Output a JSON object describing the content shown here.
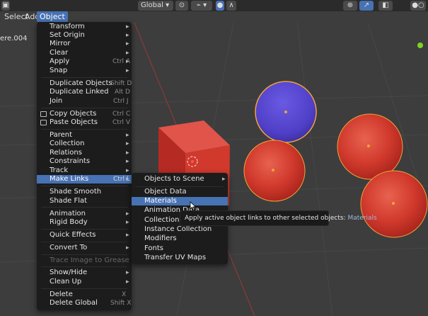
{
  "header": {
    "menus": [
      "Select",
      "Add",
      "Object"
    ],
    "orientation": "Global"
  },
  "viewport": {
    "object_name": "ere.004"
  },
  "object_menu": {
    "items": [
      {
        "label": "Transform",
        "shortcut": "",
        "submenu": true
      },
      {
        "label": "Set Origin",
        "shortcut": "",
        "submenu": true
      },
      {
        "label": "Mirror",
        "shortcut": "",
        "submenu": true
      },
      {
        "label": "Clear",
        "shortcut": "",
        "submenu": true
      },
      {
        "label": "Apply",
        "shortcut": "Ctrl A",
        "submenu": true
      },
      {
        "label": "Snap",
        "shortcut": "",
        "submenu": true
      },
      {
        "label": "Duplicate Objects",
        "shortcut": "Shift D"
      },
      {
        "label": "Duplicate Linked",
        "shortcut": "Alt D"
      },
      {
        "label": "Join",
        "shortcut": "Ctrl J"
      },
      {
        "label": "Copy Objects",
        "shortcut": "Ctrl C"
      },
      {
        "label": "Paste Objects",
        "shortcut": "Ctrl V"
      },
      {
        "label": "Parent",
        "shortcut": "",
        "submenu": true
      },
      {
        "label": "Collection",
        "shortcut": "",
        "submenu": true
      },
      {
        "label": "Relations",
        "shortcut": "",
        "submenu": true
      },
      {
        "label": "Constraints",
        "shortcut": "",
        "submenu": true
      },
      {
        "label": "Track",
        "shortcut": "",
        "submenu": true
      },
      {
        "label": "Make Links",
        "shortcut": "Ctrl L",
        "submenu": true
      },
      {
        "label": "Shade Smooth",
        "shortcut": ""
      },
      {
        "label": "Shade Flat",
        "shortcut": ""
      },
      {
        "label": "Animation",
        "shortcut": "",
        "submenu": true
      },
      {
        "label": "Rigid Body",
        "shortcut": "",
        "submenu": true
      },
      {
        "label": "Quick Effects",
        "shortcut": "",
        "submenu": true
      },
      {
        "label": "Convert To",
        "shortcut": "",
        "submenu": true
      },
      {
        "label": "Trace Image to Grease Pencil",
        "shortcut": ""
      },
      {
        "label": "Show/Hide",
        "shortcut": "",
        "submenu": true
      },
      {
        "label": "Clean Up",
        "shortcut": "",
        "submenu": true
      },
      {
        "label": "Delete",
        "shortcut": "X"
      },
      {
        "label": "Delete Global",
        "shortcut": "Shift X"
      }
    ]
  },
  "make_links_menu": {
    "items": [
      {
        "label": "Objects to Scene",
        "submenu": true
      },
      {
        "label": "Object Data"
      },
      {
        "label": "Materials"
      },
      {
        "label": "Animation Data"
      },
      {
        "label": "Collection"
      },
      {
        "label": "Instance Collection"
      },
      {
        "label": "Modifiers"
      },
      {
        "label": "Fonts"
      },
      {
        "label": "Transfer UV Maps"
      }
    ]
  },
  "tooltip": {
    "text": "Apply active object links to other selected objects:",
    "value": "Materials"
  },
  "colors": {
    "accent": "#4772b3",
    "menu_bg": "#1c1c1c",
    "red_object": "#d0392c",
    "blue_object": "#5545cf",
    "selection_outline": "#f2a33a",
    "viewport_bg": "#3d3d3d"
  }
}
